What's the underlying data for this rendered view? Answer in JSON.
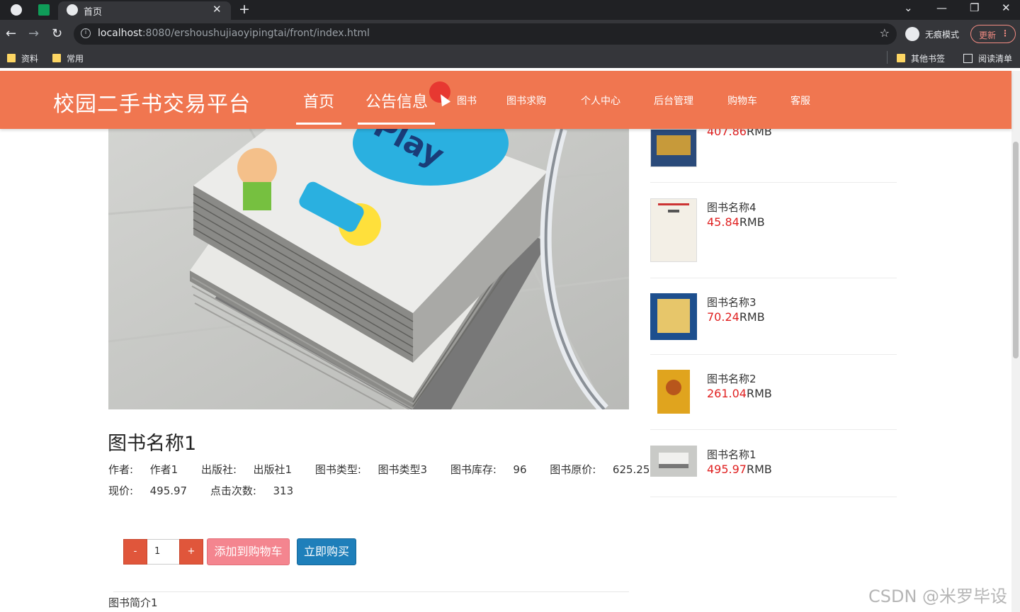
{
  "browser": {
    "tab_title": "首页",
    "url_host": "localhost",
    "url_rest": ":8080/ershoushujiaoyipingtai/front/index.html",
    "profile_label": "无痕模式",
    "update_label": "更新",
    "bookmarks": [
      "资料",
      "常用"
    ],
    "bookmarks_right": [
      "其他书签",
      "阅读清单"
    ]
  },
  "site": {
    "brand": "校园二手书交易平台",
    "nav": [
      "首页",
      "公告信息",
      "图书",
      "图书求购",
      "个人中心",
      "后台管理",
      "购物车",
      "客服"
    ]
  },
  "detail": {
    "title": "图书名称1",
    "author_label": "作者:",
    "author": "作者1",
    "publisher_label": "出版社:",
    "publisher": "出版社1",
    "type_label": "图书类型:",
    "type": "图书类型3",
    "stock_label": "图书库存:",
    "stock": "96",
    "orig_price_label": "图书原价:",
    "orig_price": "625.25",
    "price_label": "现价:",
    "price": "495.97",
    "clicks_label": "点击次数:",
    "clicks": "313",
    "qty_minus": "-",
    "qty_value": "1",
    "qty_plus": "+",
    "add_to_cart": "添加到购物车",
    "buy_now": "立即购买",
    "intro": "图书简介1"
  },
  "sidebar": [
    {
      "name": "",
      "price": "407.86",
      "unit": "RMB",
      "color": "#2a4a7a"
    },
    {
      "name": "图书名称4",
      "price": "45.84",
      "unit": "RMB",
      "color": "#f3efe6"
    },
    {
      "name": "图书名称3",
      "price": "70.24",
      "unit": "RMB",
      "color": "#1d4f8e"
    },
    {
      "name": "图书名称2",
      "price": "261.04",
      "unit": "RMB",
      "color": "#e0a41e"
    },
    {
      "name": "图书名称1",
      "price": "495.97",
      "unit": "RMB",
      "color": "#9aa2a8"
    }
  ],
  "watermark": "CSDN @米罗毕设",
  "colors": {
    "header": "#f07650",
    "price": "#e02020",
    "cart_button": "#f4858f",
    "buy_button": "#1e7fba"
  }
}
